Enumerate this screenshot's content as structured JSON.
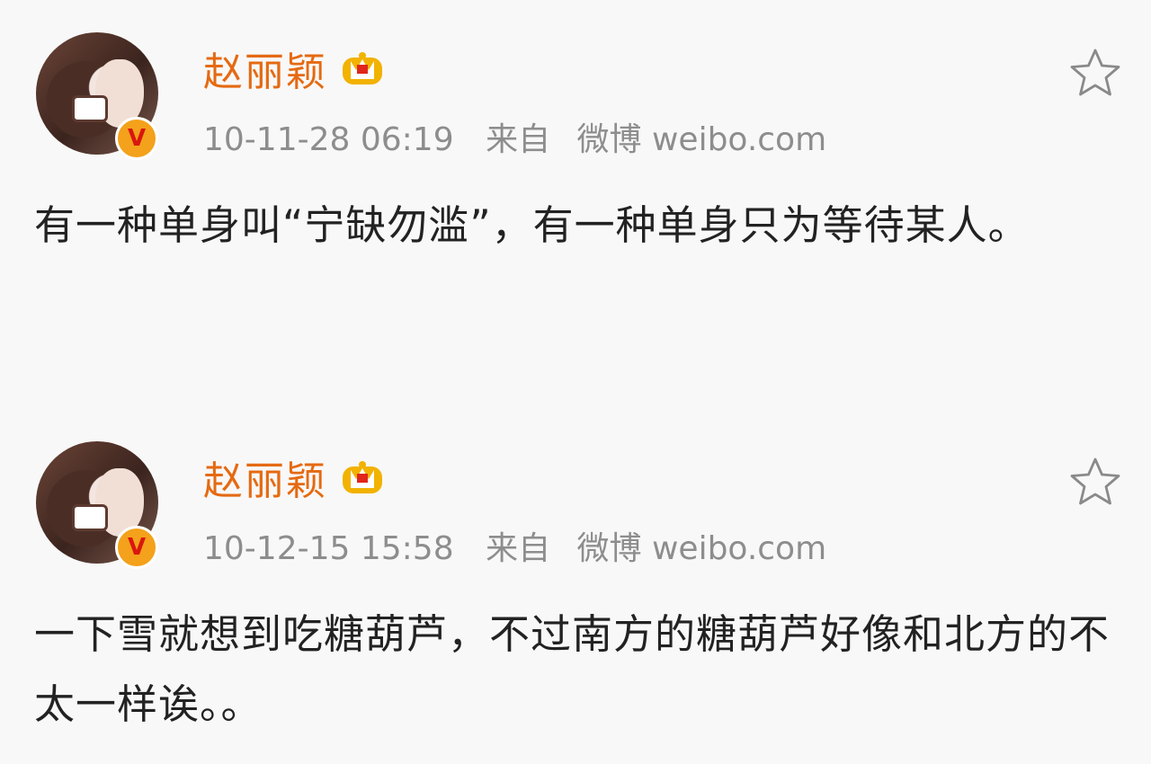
{
  "posts": [
    {
      "username": "赵丽颖",
      "timestamp": "10-11-28 06:19",
      "source_label": "来自",
      "source_app": "微博 weibo.com",
      "verified_badge": "V",
      "text": "有一种单身叫“宁缺勿滥”，有一种单身只为等待某人。",
      "icons": [
        "avatar",
        "verified-badge-icon",
        "crown-icon",
        "star-icon"
      ]
    },
    {
      "username": "赵丽颖",
      "timestamp": "10-12-15 15:58",
      "source_label": "来自",
      "source_app": "微博 weibo.com",
      "verified_badge": "V",
      "text": "一下雪就想到吃糖葫芦，不过南方的糖葫芦好像和北方的不太一样诶。。",
      "icons": [
        "avatar",
        "verified-badge-icon",
        "crown-icon",
        "star-icon"
      ]
    }
  ],
  "colors": {
    "username": "#e56a12",
    "meta": "#8d8d8d",
    "body_text": "#222222",
    "background": "#f8f8f8",
    "badge": "#f4a11b",
    "badge_text": "#d9160f"
  }
}
